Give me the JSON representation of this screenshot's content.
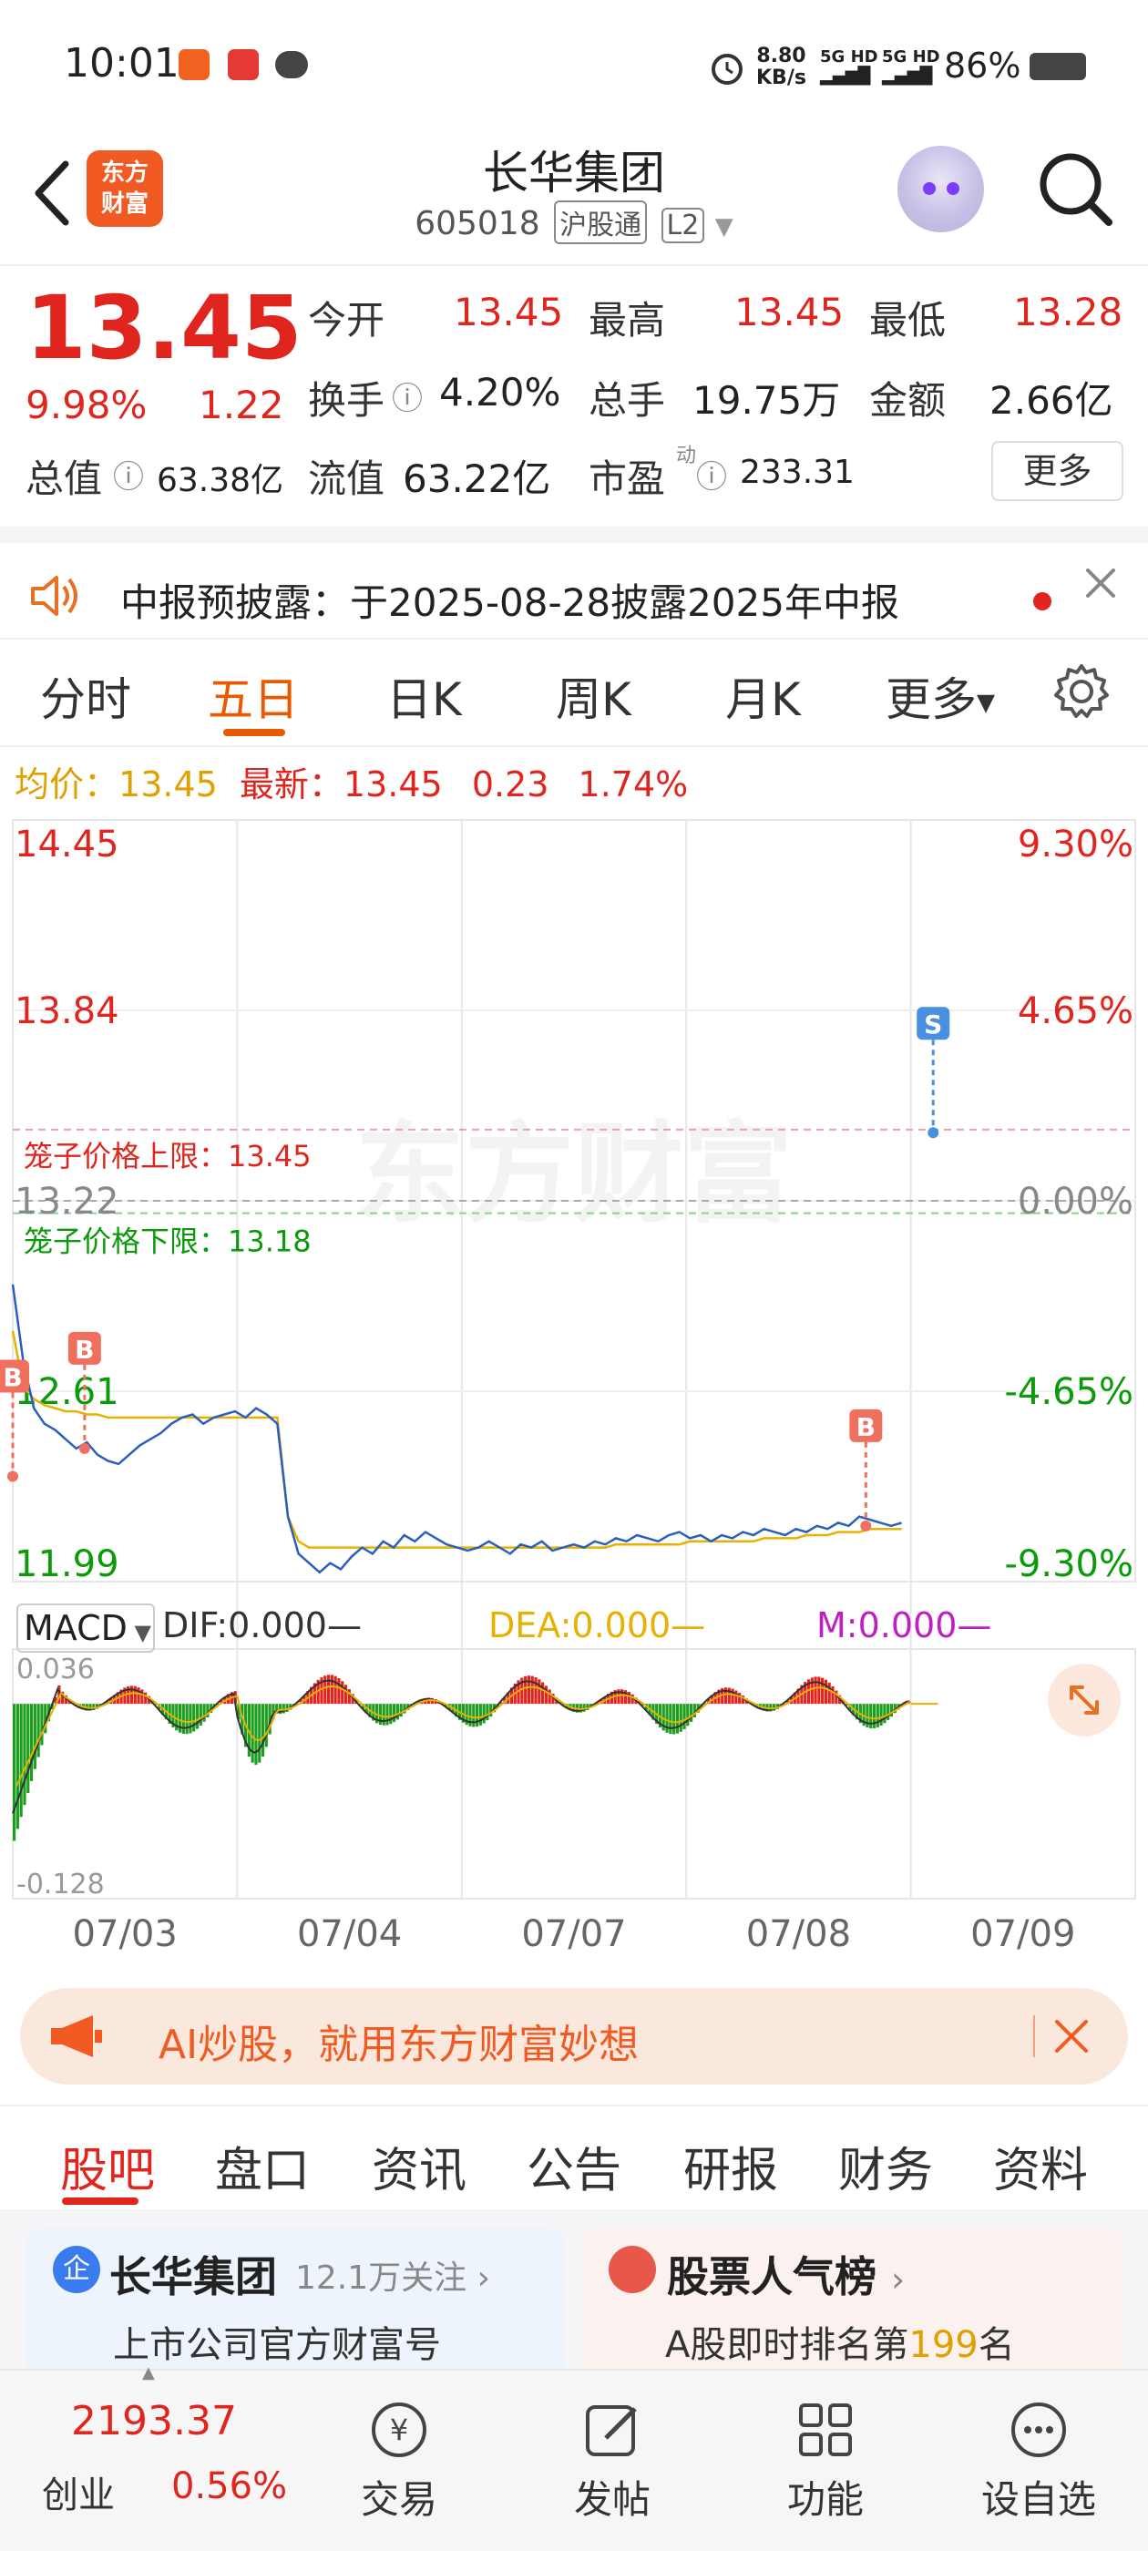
{
  "status_bar": {
    "time": "10:01",
    "net_speed": "8.80",
    "net_unit": "KB/s",
    "network1": "5G HD",
    "network2": "5G HD",
    "battery": "86%"
  },
  "header": {
    "logo_line1": "东方",
    "logo_line2": "财富",
    "title": "长华集团",
    "code": "605018",
    "tag1": "沪股通",
    "tag2": "L2"
  },
  "quote": {
    "price": "13.45",
    "change_pct": "9.98%",
    "change": "1.22",
    "open_label": "今开",
    "open": "13.45",
    "high_label": "最高",
    "high": "13.45",
    "low_label": "最低",
    "low": "13.28",
    "turnover_label": "换手",
    "turnover": "4.20%",
    "volume_label": "总手",
    "volume": "19.75万",
    "amount_label": "金额",
    "amount": "2.66亿",
    "mktcap_label": "总值",
    "mktcap": "63.38亿",
    "float_label": "流值",
    "float": "63.22亿",
    "pe_label": "市盈",
    "pe_sup": "动",
    "pe": "233.31",
    "more_label": "更多"
  },
  "notice": {
    "text": "中报预披露：于2025-08-28披露2025年中报"
  },
  "chart_tabs": {
    "tabs": [
      "分时",
      "五日",
      "日K",
      "周K",
      "月K",
      "更多"
    ],
    "active": "五日"
  },
  "info_line": {
    "avg_label": "均价：",
    "avg": "13.45",
    "latest_label": "最新：",
    "latest": "13.45",
    "chg": "0.23",
    "chg_pct": "1.74%"
  },
  "chart_data": [
    {
      "type": "line",
      "y_ticks_left": [
        "14.45",
        "13.84",
        "13.22",
        "12.61",
        "11.99"
      ],
      "y_ticks_right": [
        "9.30%",
        "4.65%",
        "0.00%",
        "-4.65%",
        "-9.30%"
      ],
      "ylim": [
        11.99,
        14.45
      ],
      "prev_close": 13.22,
      "upper_limit_label": "笼子价格上限：13.45",
      "upper_limit": 13.45,
      "lower_limit_label": "笼子价格下限：13.18",
      "lower_limit": 13.18,
      "watermark": "东方财富",
      "x_labels": [
        "07/03",
        "07/04",
        "07/07",
        "07/08",
        "07/09"
      ],
      "markers": [
        {
          "label": "B",
          "day": 0,
          "t": 0.0,
          "price": 12.33
        },
        {
          "label": "B",
          "day": 0,
          "t": 0.32,
          "price": 12.42
        },
        {
          "label": "B",
          "day": 3,
          "t": 0.8,
          "price": 12.17
        },
        {
          "label": "S",
          "day": 4,
          "t": 0.1,
          "price": 13.44
        }
      ],
      "series": [
        {
          "name": "price",
          "color": "#2a5fbf",
          "values": [
            12.95,
            12.7,
            12.55,
            12.5,
            12.48,
            12.45,
            12.42,
            12.44,
            12.4,
            12.38,
            12.37,
            12.4,
            12.43,
            12.45,
            12.47,
            12.5,
            12.52,
            12.53,
            12.5,
            12.52,
            12.53,
            12.54,
            12.52,
            12.55,
            12.53,
            12.5,
            12.2,
            12.08,
            12.05,
            12.02,
            12.05,
            12.03,
            12.07,
            12.1,
            12.08,
            12.12,
            12.1,
            12.14,
            12.12,
            12.15,
            12.13,
            12.11,
            12.1,
            12.09,
            12.1,
            12.12,
            12.1,
            12.08,
            12.11,
            12.1,
            12.12,
            12.09,
            12.1,
            12.11,
            12.1,
            12.12,
            12.11,
            12.13,
            12.12,
            12.14,
            12.13,
            12.12,
            12.14,
            12.15,
            12.13,
            12.14,
            12.12,
            12.14,
            12.13,
            12.15,
            12.14,
            12.16,
            12.15,
            12.14,
            12.16,
            12.15,
            12.17,
            12.16,
            12.18,
            12.17,
            12.2,
            12.19,
            12.18,
            12.17,
            12.18
          ]
        },
        {
          "name": "avg",
          "color": "#e8b000",
          "values": [
            12.8,
            12.62,
            12.58,
            12.56,
            12.55,
            12.54,
            12.54,
            12.53,
            12.53,
            12.52,
            12.52,
            12.52,
            12.52,
            12.52,
            12.52,
            12.52,
            12.52,
            12.52,
            12.52,
            12.52,
            12.52,
            12.52,
            12.52,
            12.52,
            12.52,
            12.52,
            12.2,
            12.12,
            12.1,
            12.1,
            12.1,
            12.1,
            12.1,
            12.1,
            12.1,
            12.1,
            12.1,
            12.1,
            12.1,
            12.1,
            12.1,
            12.1,
            12.1,
            12.1,
            12.1,
            12.1,
            12.1,
            12.1,
            12.1,
            12.1,
            12.1,
            12.1,
            12.1,
            12.1,
            12.1,
            12.1,
            12.1,
            12.11,
            12.11,
            12.11,
            12.11,
            12.11,
            12.11,
            12.11,
            12.12,
            12.12,
            12.12,
            12.12,
            12.12,
            12.12,
            12.12,
            12.13,
            12.13,
            12.13,
            12.13,
            12.14,
            12.14,
            12.14,
            12.15,
            12.15,
            12.15,
            12.16,
            12.16,
            12.16,
            12.16
          ]
        }
      ]
    },
    {
      "type": "bar",
      "indicator": "MACD",
      "dif_label": "DIF:0.000",
      "dea_label": "DEA:0.000",
      "m_label": "M:0.000",
      "top_tick": "0.036",
      "bottom_tick": "-0.128",
      "ylim": [
        -0.128,
        0.036
      ]
    }
  ],
  "ad": {
    "text": "AI炒股，就用东方财富妙想"
  },
  "bottom_tabs": {
    "tabs": [
      "股吧",
      "盘口",
      "资讯",
      "公告",
      "研报",
      "财务",
      "资料"
    ],
    "active": "股吧"
  },
  "cards": {
    "card1_title": "长华集团",
    "card1_follow": "12.1万关注",
    "card1_sub": "上市公司官方财富号",
    "card2_title": "股票人气榜",
    "card2_sub_pre": "A股即时排名第",
    "card2_rank": "199",
    "card2_sub_post": "名"
  },
  "bottom_nav": {
    "index_value": "2193.37",
    "index_name": "创业",
    "index_pct": "0.56%",
    "items": [
      "交易",
      "发帖",
      "功能",
      "设自选"
    ]
  }
}
